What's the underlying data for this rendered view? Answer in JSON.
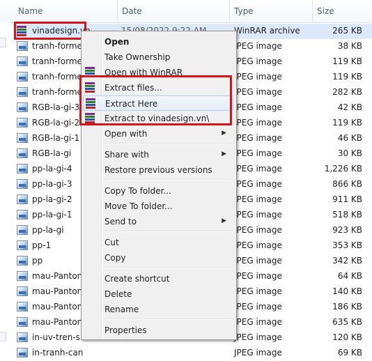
{
  "columns": {
    "name": "Name",
    "date": "Date",
    "type": "Type",
    "size": "Size"
  },
  "files": [
    {
      "name": "vinadesign.vn",
      "date": "15/08/2022 9:22 AM",
      "type": "WinRAR archive",
      "size": "265 KB",
      "icon": "rar-icon",
      "selected": true
    },
    {
      "name": "tranh-formex",
      "type": "JPEG image",
      "size": "38 KB",
      "icon": "jpeg-icon"
    },
    {
      "name": "tranh-formex",
      "type": "JPEG image",
      "size": "119 KB",
      "icon": "jpeg-icon"
    },
    {
      "name": "tranh-formex",
      "type": "JPEG image",
      "size": "119 KB",
      "icon": "jpeg-icon"
    },
    {
      "name": "tranh-formex",
      "type": "JPEG image",
      "size": "282 KB",
      "icon": "jpeg-icon"
    },
    {
      "name": "RGB-la-gi-3",
      "type": "JPEG image",
      "size": "42 KB",
      "icon": "jpeg-icon"
    },
    {
      "name": "RGB-la-gi-2",
      "type": "JPEG image",
      "size": "119 KB",
      "icon": "jpeg-icon"
    },
    {
      "name": "RGB-la-gi-1",
      "type": "JPEG image",
      "size": "46 KB",
      "icon": "jpeg-icon"
    },
    {
      "name": "RGB-la-gi",
      "type": "JPEG image",
      "size": "30 KB",
      "icon": "jpeg-icon"
    },
    {
      "name": "pp-la-gi-4",
      "type": "JPEG image",
      "size": "1,226 KB",
      "icon": "jpeg-icon"
    },
    {
      "name": "pp-la-gi-3",
      "type": "JPEG image",
      "size": "866 KB",
      "icon": "jpeg-icon"
    },
    {
      "name": "pp-la-gi-2",
      "type": "JPEG image",
      "size": "911 KB",
      "icon": "jpeg-icon"
    },
    {
      "name": "pp-la-gi-1",
      "type": "JPEG image",
      "size": "518 KB",
      "icon": "jpeg-icon"
    },
    {
      "name": "pp-la-gi",
      "type": "JPEG image",
      "size": "923 KB",
      "icon": "jpeg-icon"
    },
    {
      "name": "pp-1",
      "type": "JPEG image",
      "size": "353 KB",
      "icon": "jpeg-icon"
    },
    {
      "name": "pp",
      "type": "JPEG image",
      "size": "342 KB",
      "icon": "jpeg-icon"
    },
    {
      "name": "mau-Panton",
      "type": "JPEG image",
      "size": "64 KB",
      "icon": "jpeg-icon"
    },
    {
      "name": "mau-Panton",
      "type": "JPEG image",
      "size": "140 KB",
      "icon": "jpeg-icon"
    },
    {
      "name": "mau-Panton",
      "type": "JPEG image",
      "size": "186 KB",
      "icon": "jpeg-icon"
    },
    {
      "name": "mau-Panton",
      "type": "JPEG image",
      "size": "635 KB",
      "icon": "jpeg-icon"
    },
    {
      "name": "in-uv-tren-si",
      "type": "JPEG image",
      "size": "120 KB",
      "icon": "jpeg-icon"
    },
    {
      "name": "in-tranh-can",
      "type": "JPEG image",
      "size": "69 KB",
      "icon": "jpeg-icon"
    }
  ],
  "context_menu": {
    "items": [
      {
        "label": "Open",
        "bold": true
      },
      {
        "label": "Take Ownership"
      },
      {
        "label": "Open with WinRAR",
        "icon": "winrar-icon"
      },
      {
        "separator": true
      },
      {
        "label": "Extract files...",
        "icon": "winrar-icon"
      },
      {
        "label": "Extract Here",
        "icon": "winrar-icon",
        "highlighted": true
      },
      {
        "label": "Extract to vinadesign.vn\\",
        "icon": "winrar-icon"
      },
      {
        "separator": true
      },
      {
        "label": "Open with",
        "submenu": true
      },
      {
        "separator": true
      },
      {
        "label": "Share with",
        "submenu": true
      },
      {
        "label": "Restore previous versions"
      },
      {
        "separator": true
      },
      {
        "label": "Copy To folder..."
      },
      {
        "label": "Move To folder..."
      },
      {
        "label": "Send to",
        "submenu": true
      },
      {
        "separator": true
      },
      {
        "label": "Cut"
      },
      {
        "label": "Copy"
      },
      {
        "separator": true
      },
      {
        "label": "Create shortcut"
      },
      {
        "label": "Delete"
      },
      {
        "label": "Rename"
      },
      {
        "separator": true
      },
      {
        "label": "Properties"
      }
    ]
  },
  "colors": {
    "annotation_red": "#d0161c",
    "selection": "#dbe9fb"
  },
  "glyphs": {
    "submenu_arrow": "▶"
  }
}
